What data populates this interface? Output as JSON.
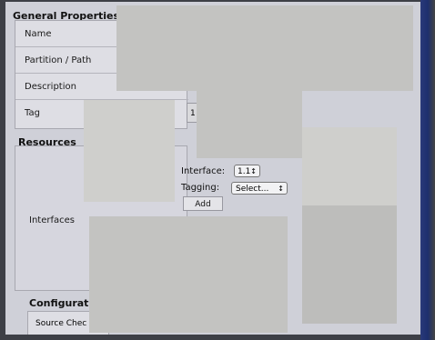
{
  "general_properties": {
    "header": "General Properties",
    "rows": [
      "Name",
      "Partition / Path",
      "Description",
      "Tag"
    ]
  },
  "tag_value": "1",
  "resources": {
    "header": "Resources",
    "interfaces_label": "Interfaces",
    "interface_label": "Interface:",
    "interface_value": "1.1",
    "tagging_label": "Tagging:",
    "tagging_value": "Select...",
    "add_button": "Add",
    "stepper_glyph": "↕"
  },
  "configuration": {
    "header": "Configuration",
    "source_check_label": "Source Chec"
  }
}
